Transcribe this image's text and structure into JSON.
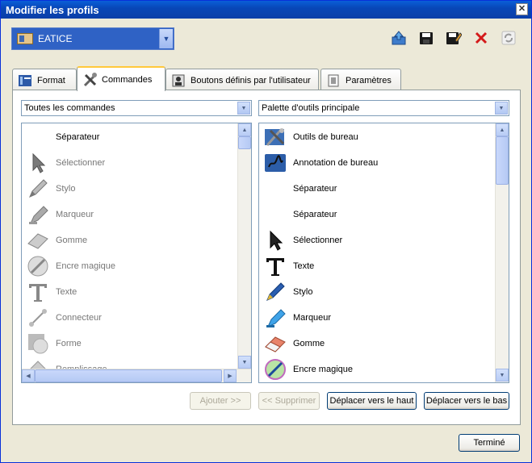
{
  "window": {
    "title": "Modifier les profils"
  },
  "profile": {
    "selected": "EATICE"
  },
  "tabs": [
    {
      "label": "Format",
      "icon": "format-icon"
    },
    {
      "label": "Commandes",
      "icon": "tools-icon"
    },
    {
      "label": "Boutons définis par l'utilisateur",
      "icon": "user-buttons-icon"
    },
    {
      "label": "Paramètres",
      "icon": "settings-icon"
    }
  ],
  "left": {
    "filter": "Toutes les commandes",
    "items": [
      {
        "label": "Séparateur",
        "icon": ""
      },
      {
        "label": "Sélectionner",
        "icon": "select-arrow-icon"
      },
      {
        "label": "Stylo",
        "icon": "pen-icon"
      },
      {
        "label": "Marqueur",
        "icon": "marker-icon"
      },
      {
        "label": "Gomme",
        "icon": "eraser-icon"
      },
      {
        "label": "Encre magique",
        "icon": "magic-ink-icon"
      },
      {
        "label": "Texte",
        "icon": "text-icon"
      },
      {
        "label": "Connecteur",
        "icon": "connector-icon"
      },
      {
        "label": "Forme",
        "icon": "shape-icon"
      },
      {
        "label": "Remplissage",
        "icon": "fill-icon"
      }
    ]
  },
  "right": {
    "palette": "Palette d'outils principale",
    "items": [
      {
        "label": "Outils de bureau",
        "icon": "desktop-tools-icon"
      },
      {
        "label": "Annotation de bureau",
        "icon": "desktop-annotation-icon"
      },
      {
        "label": "Séparateur",
        "icon": ""
      },
      {
        "label": "Séparateur",
        "icon": ""
      },
      {
        "label": "Sélectionner",
        "icon": "select-arrow-icon"
      },
      {
        "label": "Texte",
        "icon": "text-icon"
      },
      {
        "label": "Stylo",
        "icon": "pen-icon"
      },
      {
        "label": "Marqueur",
        "icon": "marker-icon"
      },
      {
        "label": "Gomme",
        "icon": "eraser-icon"
      },
      {
        "label": "Encre magique",
        "icon": "magic-ink-icon"
      }
    ]
  },
  "buttons": {
    "add": "Ajouter >>",
    "remove": "<< Supprimer",
    "move_up": "Déplacer vers le haut",
    "move_down": "Déplacer vers le bas",
    "done": "Terminé"
  }
}
